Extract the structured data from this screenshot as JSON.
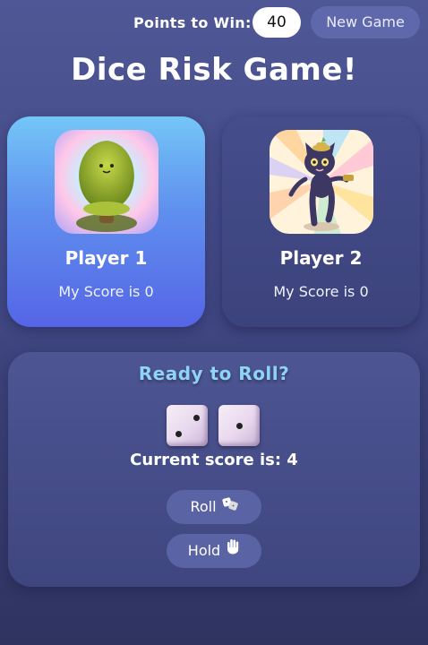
{
  "header": {
    "points_label": "Points to Win:",
    "points_value": "40",
    "new_game_label": "New Game"
  },
  "title": "Dice Risk Game!",
  "players": [
    {
      "name": "Player 1",
      "score_text": "My Score is 0",
      "active": true
    },
    {
      "name": "Player 2",
      "score_text": "My Score is 0",
      "active": false
    }
  ],
  "game": {
    "prompt": "Ready to Roll?",
    "dice": [
      2,
      1
    ],
    "current_score_text": "Current score is: 4",
    "roll_label": "Roll",
    "hold_label": "Hold",
    "roll_icon": "dice-icon",
    "hold_icon": "hand-icon"
  },
  "colors": {
    "background": "#414884",
    "active_card": "#5f8fee",
    "inactive_card": "#3f467f",
    "prompt": "#8fd3f7",
    "button": "#5a63a4"
  }
}
